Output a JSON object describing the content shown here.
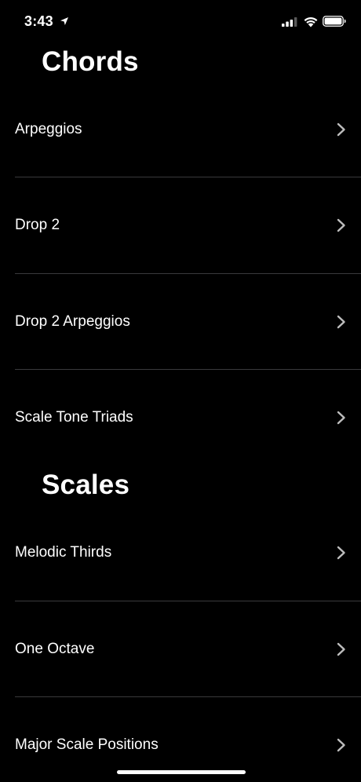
{
  "status_bar": {
    "time": "3:43",
    "icons": [
      "location-arrow-icon",
      "cellular-signal-icon",
      "wifi-icon",
      "battery-icon"
    ]
  },
  "colors": {
    "background": "#000000",
    "text": "#ffffff",
    "divider": "#3a3a3c",
    "chevron": "#bdbdbd"
  },
  "sections": [
    {
      "title": "Chords",
      "items": [
        {
          "label": "Arpeggios",
          "icon": "chevron-right-icon"
        },
        {
          "label": "Drop 2",
          "icon": "chevron-right-icon"
        },
        {
          "label": "Drop 2 Arpeggios",
          "icon": "chevron-right-icon"
        },
        {
          "label": "Scale Tone Triads",
          "icon": "chevron-right-icon"
        }
      ]
    },
    {
      "title": "Scales",
      "items": [
        {
          "label": "Melodic Thirds",
          "icon": "chevron-right-icon"
        },
        {
          "label": "One Octave",
          "icon": "chevron-right-icon"
        },
        {
          "label": "Major Scale Positions",
          "icon": "chevron-right-icon"
        }
      ]
    }
  ]
}
